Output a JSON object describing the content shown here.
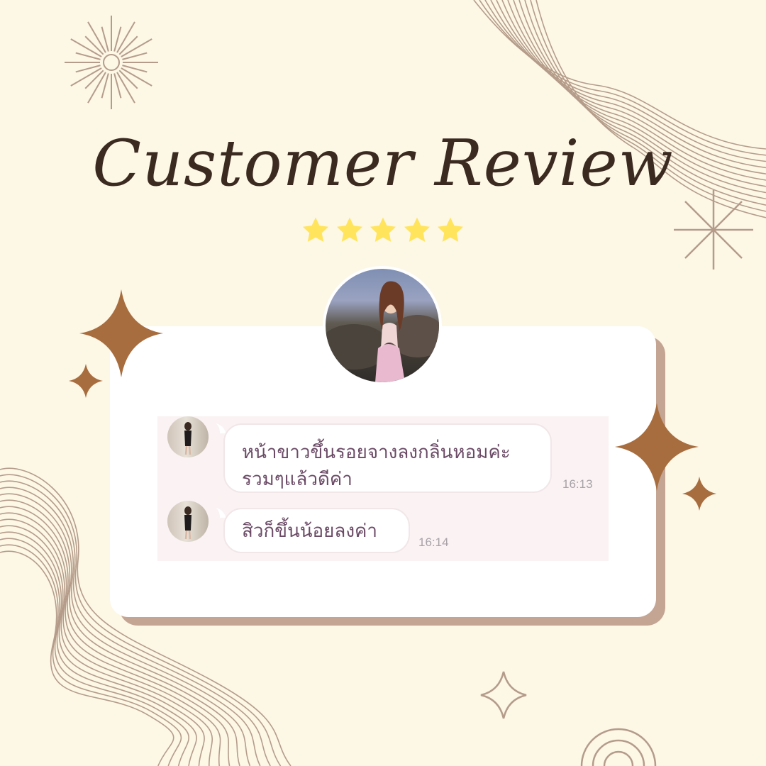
{
  "title": "Customer Review",
  "rating": {
    "stars": 5,
    "max": 5,
    "color": "#ffe45c"
  },
  "colors": {
    "background": "#fdf7e6",
    "title": "#3b2a20",
    "sparkle": "#a86d3e",
    "line_art": "#b59c8a",
    "card_shadow": "#c4a593",
    "chat_background": "#faf2f3",
    "message_text": "#6b4a66",
    "timestamp": "#a9a2a6"
  },
  "messages": [
    {
      "text_line1": "หน้าขาวขึ้นรอยจางลงกลิ่นหอมค่ะ",
      "text_line2": "รวมๆแล้วดีค่า",
      "time": "16:13"
    },
    {
      "text_line1": "สิวก็ขึ้นน้อยลงค่า",
      "time": "16:14"
    }
  ],
  "icons": {
    "rating": "star-icon",
    "decorations": [
      "sunburst-icon",
      "asterisk-icon",
      "sparkle-icon",
      "wave-lines",
      "rainbow-arcs"
    ]
  }
}
